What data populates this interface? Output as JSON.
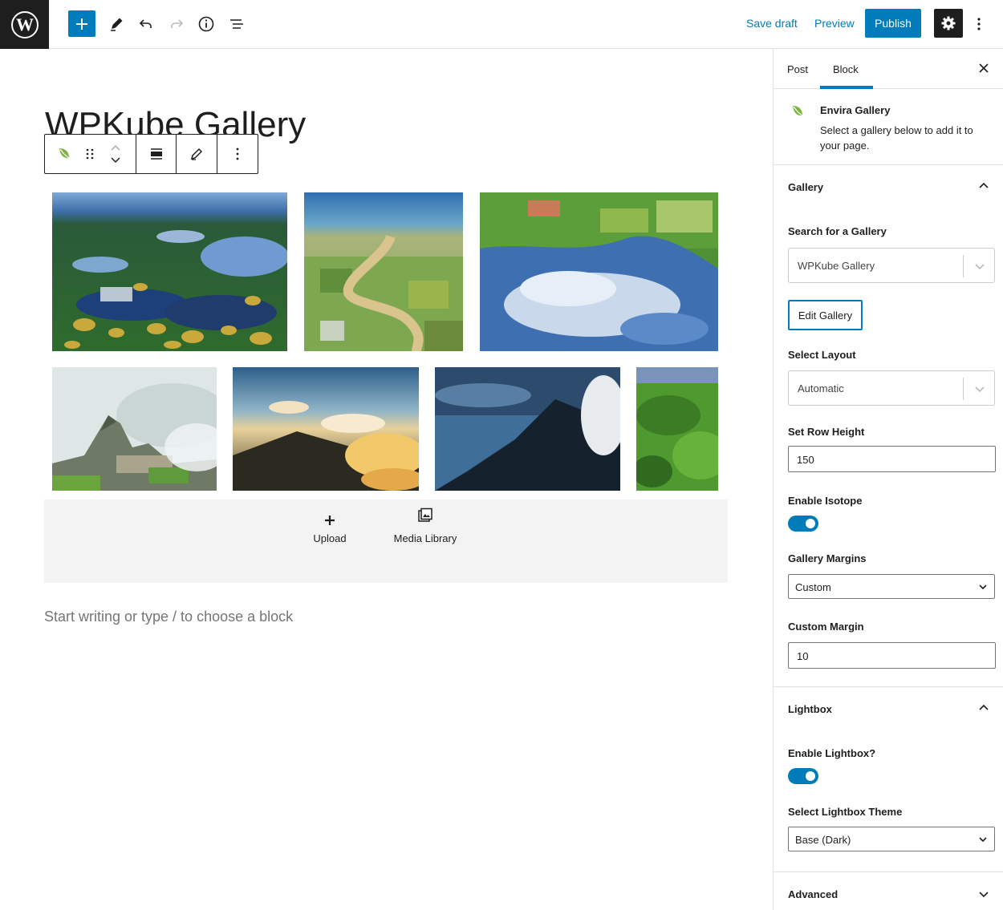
{
  "topbar": {
    "save_draft": "Save draft",
    "preview": "Preview",
    "publish": "Publish",
    "icons": [
      "wordpress-logo",
      "plus-icon",
      "pencil-icon",
      "undo-icon",
      "redo-icon",
      "info-icon",
      "list-view-icon",
      "gear-icon",
      "more-vertical-icon"
    ]
  },
  "editor": {
    "post_title": "WPKube Gallery",
    "gallery_images": [
      "aerial-lakes",
      "river-valley",
      "lake-reflection",
      "machu-picchu",
      "clouds-sunrise",
      "misty-mountain",
      "green-hills"
    ],
    "placeholder": {
      "upload_label": "Upload",
      "media_library_label": "Media Library"
    },
    "start_writing": "Start writing or type / to choose a block"
  },
  "sidebar": {
    "tabs": [
      "Post",
      "Block"
    ],
    "active_tab": "Block",
    "block_card": {
      "title": "Envira Gallery",
      "description": "Select a gallery below to add it to your page."
    },
    "gallery_panel": {
      "title": "Gallery",
      "search_label": "Search for a Gallery",
      "search_value": "WPKube Gallery",
      "edit_button": "Edit Gallery",
      "layout_label": "Select Layout",
      "layout_value": "Automatic",
      "row_height_label": "Set Row Height",
      "row_height_value": "150",
      "isotope_label": "Enable Isotope",
      "isotope_enabled": true,
      "margins_label": "Gallery Margins",
      "margins_value": "Custom",
      "custom_margin_label": "Custom Margin",
      "custom_margin_value": "10"
    },
    "lightbox_panel": {
      "title": "Lightbox",
      "enable_label": "Enable Lightbox?",
      "enabled": true,
      "theme_label": "Select Lightbox Theme",
      "theme_value": "Base (Dark)"
    },
    "advanced_panel": {
      "title": "Advanced"
    }
  },
  "colors": {
    "accent": "#007cba",
    "dark": "#1e1e1e",
    "envira_green": "#7cb342"
  }
}
